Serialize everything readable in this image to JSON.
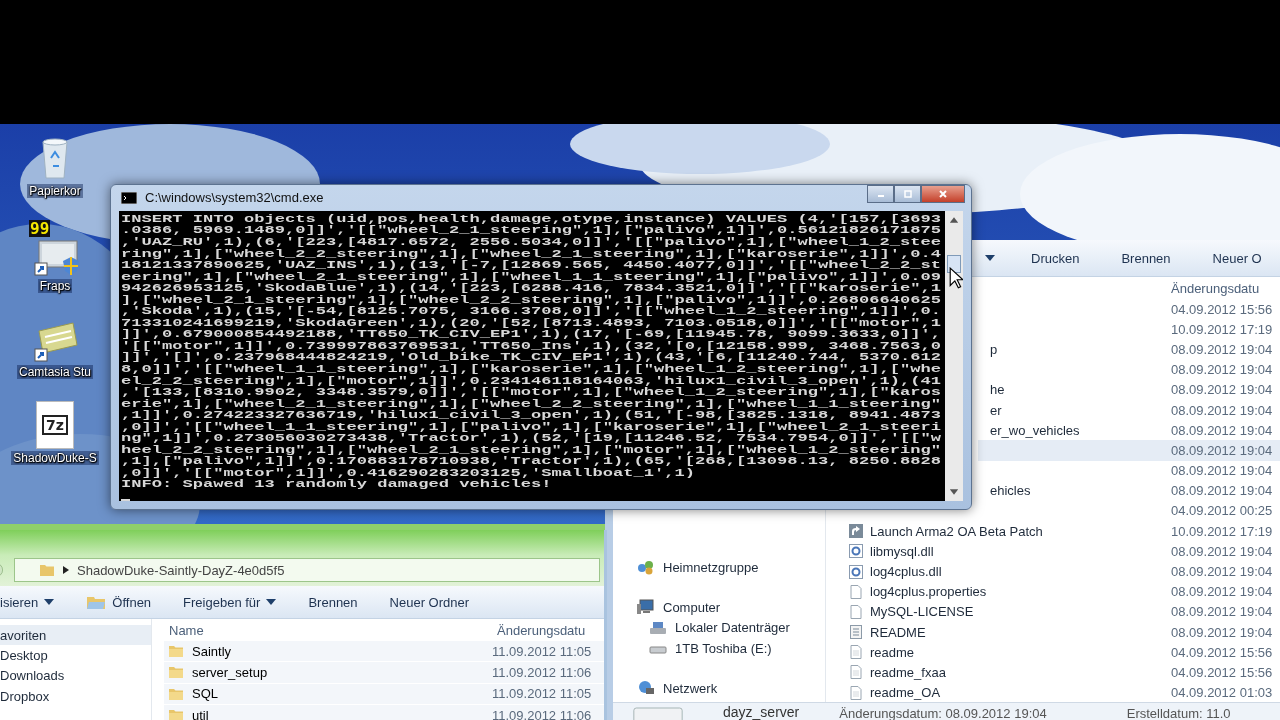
{
  "desktop_icons": [
    {
      "kind": "recycle",
      "label": "Papierkor"
    },
    {
      "kind": "fraps",
      "label": "Fraps",
      "badge": "99"
    },
    {
      "kind": "camtasia",
      "label": "Camtasia Stu"
    },
    {
      "kind": "archive",
      "label": "ShadowDuke-S",
      "badge": "7z"
    }
  ],
  "cmd": {
    "title": "C:\\windows\\system32\\cmd.exe",
    "lines": [
      "INSERT INTO objects (uid,pos,health,damage,otype,instance) VALUES (4,'[157,[3693",
      ".0386, 5969.1489,0]]','[[\"wheel_2_1_steering\",1],[\"palivo\",1]]',0.56121826171875",
      ",'UAZ_RU',1),(6,'[223,[4817.6572, 2556.5034,0]]','[[\"palivo\",1],[\"wheel_1_2_stee",
      "ring\",1],[\"wheel_2_2_steering\",1],[\"wheel_2_1_steering\",1],[\"karoserie\",1]]',0.4",
      "18121337890625,'UAZ_INS',1),(13,'[-7,[12869.565, 4450.4077,0]]','[[\"wheel_2_2_st",
      "eering\",1],[\"wheel_2_1_steering\",1],[\"wheel_1_1_steering\",1],[\"palivo\",1]]',0.09",
      "942626953125,'SkodaBlue',1),(14,'[223,[6288.416, 7834.3521,0]]','[[\"karoserie\",1",
      "],[\"wheel_2_1_steering\",1],[\"wheel_2_2_steering\",1],[\"palivo\",1]]',0.26806640625",
      ",'Skoda',1),(15,'[-54,[8125.7075, 3166.3708,0]]','[[\"wheel_1_2_steering\",1]]',0.",
      "713310241699219,'SkodaGreen',1),(20,'[52,[8713.4893, 7103.0518,0]]','[[\"motor\",1",
      "]]',0.679000854492188,'TT650_TK_CIV_EP1',1),(17,'[-69,[11945.78, 9099.3633,0]]',",
      "'[[\"motor\",1]]',0.739997863769531,'TT650_Ins',1),(32,'[0,[12158.999, 3468.7563,0",
      "]]','[]',0.237968444824219,'Old_bike_TK_CIV_EP1',1),(43,'[6,[11240.744, 5370.612",
      "8,0]]','[[\"wheel_1_1_steering\",1],[\"karoserie\",1],[\"wheel_1_2_steering\",1],[\"whe",
      "el_2_2_steering\",1],[\"motor\",1]]',0.234146118164063,'hilux1_civil_3_open',1),(41",
      ",'[133,[8310.9902, 3348.3579,0]]','[[\"motor\",1],[\"wheel_1_2_steering\",1],[\"karos",
      "erie\",1],[\"wheel_2_1_steering\",1],[\"wheel_2_2_steering\",1],[\"wheel_1_1_steering\"",
      ",1]]',0.274223327636719,'hilux1_civil_3_open',1),(51,'[-98,[3825.1318, 8941.4873",
      ",0]]','[[\"wheel_1_1_steering\",1],[\"palivo\",1],[\"karoserie\",1],[\"wheel_2_1_steeri",
      "ng\",1]]',0.273056030273438,'Tractor',1),(52,'[19,[11246.52, 7534.7954,0]]','[[\"w",
      "heel_2_2_steering\",1],[\"wheel_2_1_steering\",1],[\"motor\",1],[\"wheel_1_2_steering\"",
      ",1],[\"palivo\",1]]',0.170883178710938,'Tractor',1),(65,'[268,[13098.13, 8250.8828",
      ",0]]','[[\"motor\",1]]',0.416290283203125,'Smallboat_1',1)",
      "INFO: Spawed 13 randomly damaged vehicles!"
    ]
  },
  "explorer_right": {
    "toolbar": [
      {
        "kind": "menu"
      },
      {
        "kind": "plain",
        "label": "Drucken"
      },
      {
        "kind": "plain",
        "label": "Brennen"
      },
      {
        "kind": "plain",
        "label": "Neuer O"
      }
    ],
    "column": "Änderungsdatu",
    "nav": [
      {
        "kind": "homegroup",
        "label": "Heimnetzgruppe"
      },
      {
        "kind": "computer",
        "label": "Computer",
        "children": [
          {
            "kind": "disk",
            "label": "Lokaler Datenträger"
          },
          {
            "kind": "drive",
            "label": "1TB Toshiba (E:)"
          }
        ]
      },
      {
        "kind": "network",
        "label": "Netzwerk"
      }
    ],
    "rows": [
      {
        "date": "04.09.2012 15:56",
        "selected": false
      },
      {
        "date": "10.09.2012 17:19",
        "selected": false
      },
      {
        "name": "p",
        "date": "08.09.2012 19:04",
        "selected": false
      },
      {
        "date": "08.09.2012 19:04",
        "selected": false
      },
      {
        "name": "he",
        "date": "08.09.2012 19:04",
        "selected": false
      },
      {
        "name": "er",
        "date": "08.09.2012 19:04",
        "selected": false
      },
      {
        "name": "er_wo_vehicles",
        "date": "08.09.2012 19:04",
        "selected": false
      },
      {
        "date": "08.09.2012 19:04",
        "selected": true
      },
      {
        "date": "08.09.2012 19:04",
        "selected": false
      },
      {
        "name": "ehicles",
        "date": "08.09.2012 19:04",
        "selected": false
      },
      {
        "date": "04.09.2012 00:25",
        "selected": false
      },
      {
        "kind": "shortcut",
        "name": "Launch Arma2 OA Beta Patch",
        "date": "10.09.2012 17:19",
        "selected": false
      },
      {
        "kind": "dll",
        "name": "libmysql.dll",
        "date": "08.09.2012 19:04",
        "selected": false
      },
      {
        "kind": "dll",
        "name": "log4cplus.dll",
        "date": "08.09.2012 19:04",
        "selected": false
      },
      {
        "kind": "file",
        "name": "log4cplus.properties",
        "date": "08.09.2012 19:04",
        "selected": false
      },
      {
        "kind": "file",
        "name": "MySQL-LICENSE",
        "date": "08.09.2012 19:04",
        "selected": false
      },
      {
        "kind": "doc",
        "name": "README",
        "date": "08.09.2012 19:04",
        "selected": false
      },
      {
        "kind": "text",
        "name": "readme",
        "date": "04.09.2012 15:56",
        "selected": false
      },
      {
        "kind": "text",
        "name": "readme_fxaa",
        "date": "04.09.2012 15:56",
        "selected": false
      },
      {
        "kind": "text",
        "name": "readme_OA",
        "date": "04.09.2012 01:03",
        "selected": false
      }
    ],
    "status": {
      "name": "dayz_server",
      "modified": "Änderungsdatum: 08.09.2012 19:04",
      "created": "Erstelldatum: 11.0"
    }
  },
  "explorer_left": {
    "address": "ShadowDuke-Saintly-DayZ-4e0d5f5",
    "toolbar": [
      {
        "kind": "menu",
        "label": "isieren"
      },
      {
        "kind": "open",
        "label": "Öffnen"
      },
      {
        "kind": "menu",
        "label": "Freigeben für"
      },
      {
        "kind": "plain",
        "label": "Brennen"
      },
      {
        "kind": "plain",
        "label": "Neuer Ordner"
      }
    ],
    "nav": [
      {
        "label": "avoriten",
        "selected": true
      },
      {
        "label": "Desktop",
        "selected": false
      },
      {
        "label": "Downloads",
        "selected": false
      },
      {
        "label": "Dropbox",
        "selected": false
      }
    ],
    "columns": [
      "Name",
      "Änderungsdatu"
    ],
    "rows": [
      {
        "name": "Saintly",
        "date": "11.09.2012 11:05"
      },
      {
        "name": "server_setup",
        "date": "11.09.2012 11:06"
      },
      {
        "name": "SQL",
        "date": "11.09.2012 11:05"
      },
      {
        "name": "util",
        "date": "11.09.2012 11:06"
      }
    ]
  }
}
